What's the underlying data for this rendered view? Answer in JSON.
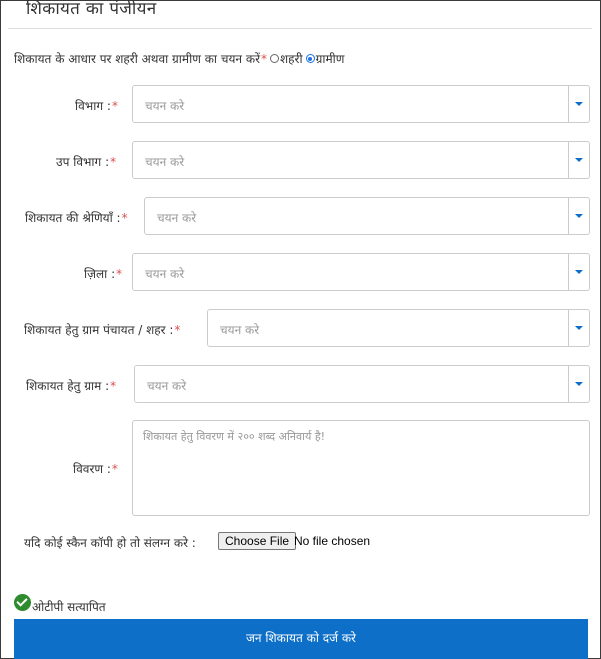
{
  "form": {
    "title": "शिकायत का पंजीयन",
    "area": {
      "label": "शिकायत के आधार पर शहरी अथवा ग्रामीण का चयन करें",
      "required_mark": "*",
      "options": [
        {
          "label": "शहरी",
          "checked": false
        },
        {
          "label": "ग्रामीण",
          "checked": true
        }
      ]
    },
    "fields": {
      "department": {
        "label": "विभाग :",
        "required_mark": "*",
        "placeholder": "चयन करे"
      },
      "sub_department": {
        "label": "उप विभाग :",
        "required_mark": "*",
        "placeholder": "चयन करे"
      },
      "category": {
        "label": "शिकायत की श्रेणियाँ :",
        "required_mark": "*",
        "placeholder": "चयन करे"
      },
      "district": {
        "label": "ज़िला :",
        "required_mark": "*",
        "placeholder": "चयन करे"
      },
      "panchayat": {
        "label": "शिकायत हेतु ग्राम पंचायत / शहर :",
        "required_mark": "*",
        "placeholder": "चयन करे"
      },
      "village": {
        "label": "शिकायत हेतु ग्राम :",
        "required_mark": "*",
        "placeholder": "चयन करे"
      },
      "description": {
        "label": "विवरण :",
        "required_mark": "*",
        "placeholder": "शिकायत हेतु विवरण में २०० शब्द अनिवार्य है!"
      }
    },
    "attachment": {
      "label": "यदि कोई स्कैन कॉपी हो तो संलग्न करे :",
      "button_label": "Choose File",
      "status": "No file chosen"
    },
    "otp_status": "ओटीपी सत्यापित",
    "submit_label": "जन शिकायत को दर्ज करे"
  },
  "colors": {
    "accent": "#0d6fc8",
    "required": "#d9534f",
    "success": "#2e8b2e"
  }
}
